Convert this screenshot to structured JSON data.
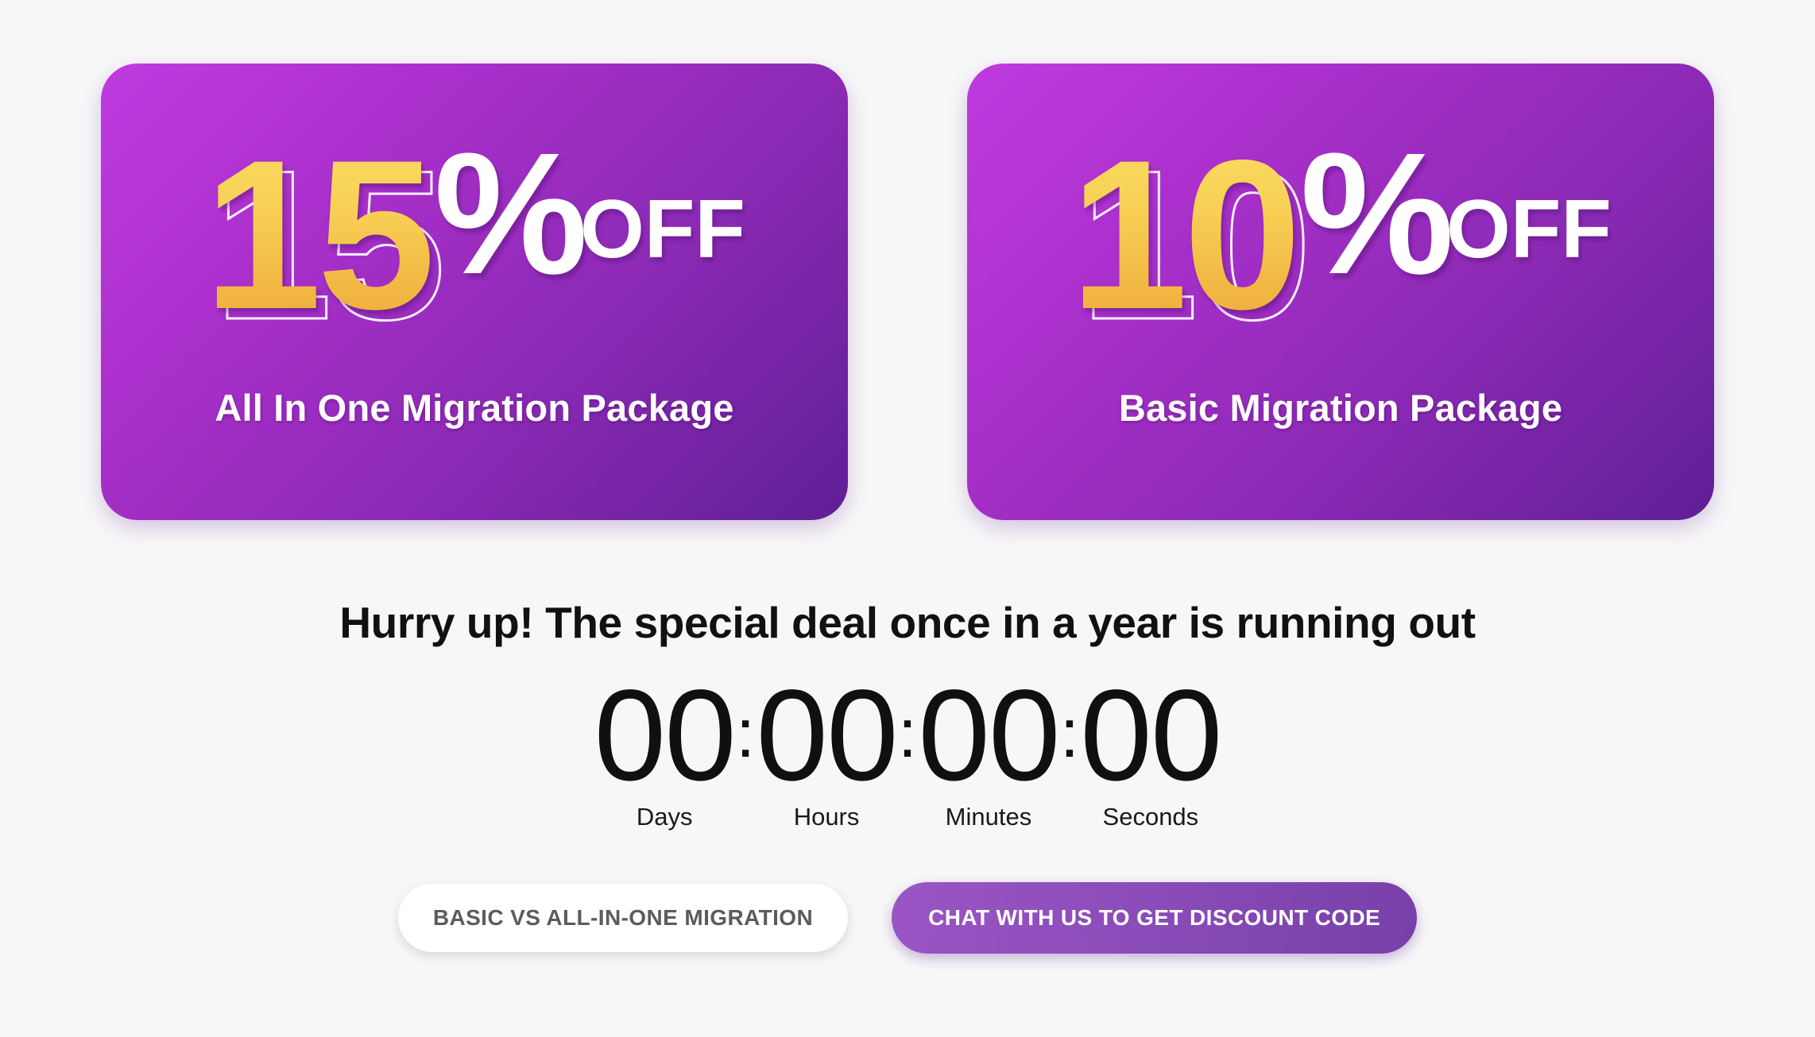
{
  "theme": {
    "page_background": "#f7f7f8",
    "card_gradient_start": "#bf3bdf",
    "card_gradient_end": "#5f1f95",
    "discount_number_gradient_start": "#f9de63",
    "discount_number_gradient_end": "#eea93a",
    "primary_button_color": "#8a4cb8",
    "secondary_button_text_color": "#5c5c5c",
    "headline_color": "#111111",
    "countdown_color": "#101010"
  },
  "offers": [
    {
      "discount_number": "15",
      "percent_sign": "%",
      "off_label": "OFF",
      "package_name": "All In One Migration Package"
    },
    {
      "discount_number": "10",
      "percent_sign": "%",
      "off_label": "OFF",
      "package_name": "Basic Migration Package"
    }
  ],
  "headline": "Hurry up! The special deal once in a year is running out",
  "countdown": {
    "separator": ":",
    "units": [
      {
        "value": "00",
        "label": "Days"
      },
      {
        "value": "00",
        "label": "Hours"
      },
      {
        "value": "00",
        "label": "Minutes"
      },
      {
        "value": "00",
        "label": "Seconds"
      }
    ]
  },
  "cta": {
    "secondary_label": "BASIC VS ALL-IN-ONE MIGRATION",
    "primary_label": "CHAT WITH US TO GET DISCOUNT CODE"
  }
}
